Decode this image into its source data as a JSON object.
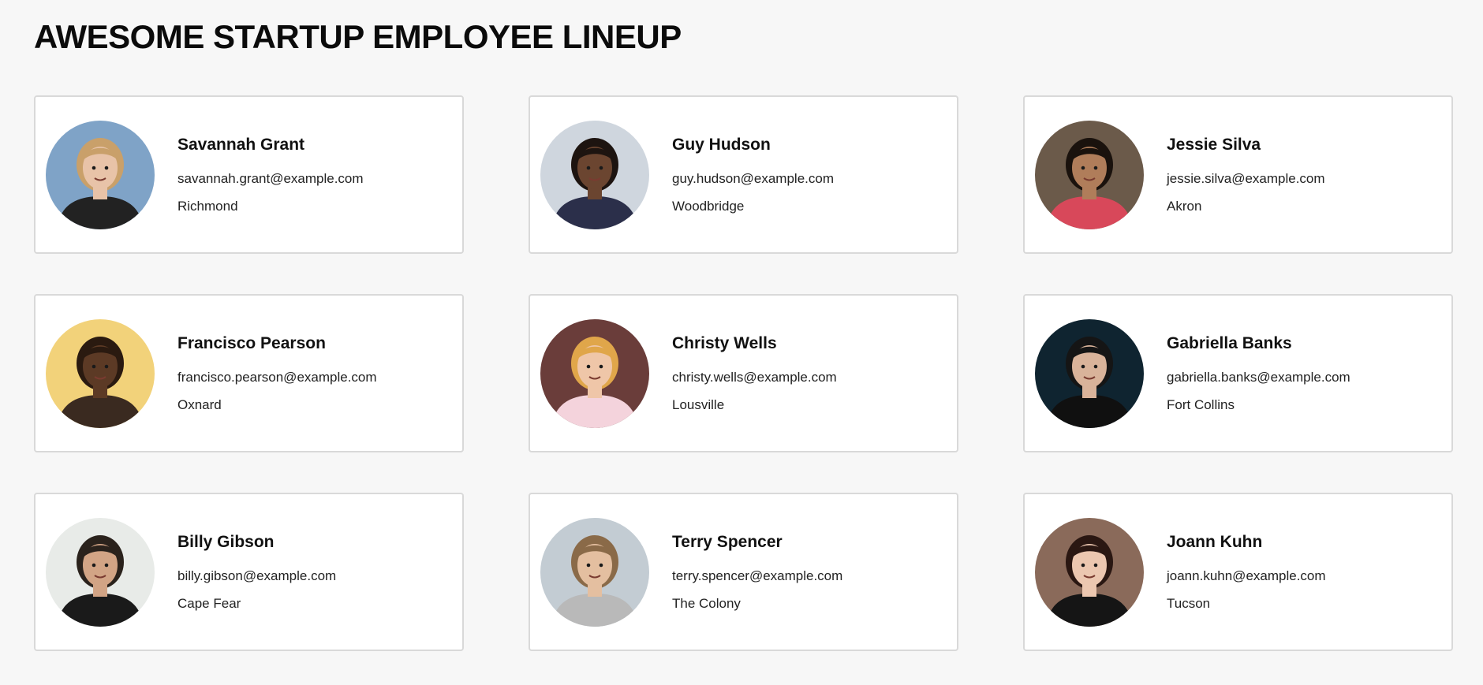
{
  "page": {
    "title": "AWESOME STARTUP EMPLOYEE LINEUP"
  },
  "employees": [
    {
      "name": "Savannah Grant",
      "email": "savannah.grant@example.com",
      "city": "Richmond",
      "photo_bg": "#7fa3c7",
      "skin": "#e8c3a8",
      "hair": "#c9a06a",
      "shirt": "#222222"
    },
    {
      "name": "Guy Hudson",
      "email": "guy.hudson@example.com",
      "city": "Woodbridge",
      "photo_bg": "#cfd6de",
      "skin": "#6b4530",
      "hair": "#1d1410",
      "shirt": "#2b2f4a"
    },
    {
      "name": "Jessie Silva",
      "email": "jessie.silva@example.com",
      "city": "Akron",
      "photo_bg": "#6b5a4a",
      "skin": "#b07d5a",
      "hair": "#1a120d",
      "shirt": "#d8485a"
    },
    {
      "name": "Francisco Pearson",
      "email": "francisco.pearson@example.com",
      "city": "Oxnard",
      "photo_bg": "#f2d27a",
      "skin": "#5c3a25",
      "hair": "#2a1a10",
      "shirt": "#3a2a20"
    },
    {
      "name": "Christy Wells",
      "email": "christy.wells@example.com",
      "city": "Lousville",
      "photo_bg": "#6a3d3a",
      "skin": "#efc6a8",
      "hair": "#e0a64a",
      "shirt": "#f4d3dc"
    },
    {
      "name": "Gabriella Banks",
      "email": "gabriella.banks@example.com",
      "city": "Fort Collins",
      "photo_bg": "#0f2430",
      "skin": "#d9b39a",
      "hair": "#151515",
      "shirt": "#101010"
    },
    {
      "name": "Billy Gibson",
      "email": "billy.gibson@example.com",
      "city": "Cape Fear",
      "photo_bg": "#e8ebe8",
      "skin": "#d2a485",
      "hair": "#2a221c",
      "shirt": "#1a1a1a"
    },
    {
      "name": "Terry Spencer",
      "email": "terry.spencer@example.com",
      "city": "The Colony",
      "photo_bg": "#c3ccd3",
      "skin": "#e4bfa0",
      "hair": "#8a6a48",
      "shirt": "#b9b9b9"
    },
    {
      "name": "Joann Kuhn",
      "email": "joann.kuhn@example.com",
      "city": "Tucson",
      "photo_bg": "#8a6a5a",
      "skin": "#ecc7b0",
      "hair": "#2a1712",
      "shirt": "#151515"
    }
  ]
}
